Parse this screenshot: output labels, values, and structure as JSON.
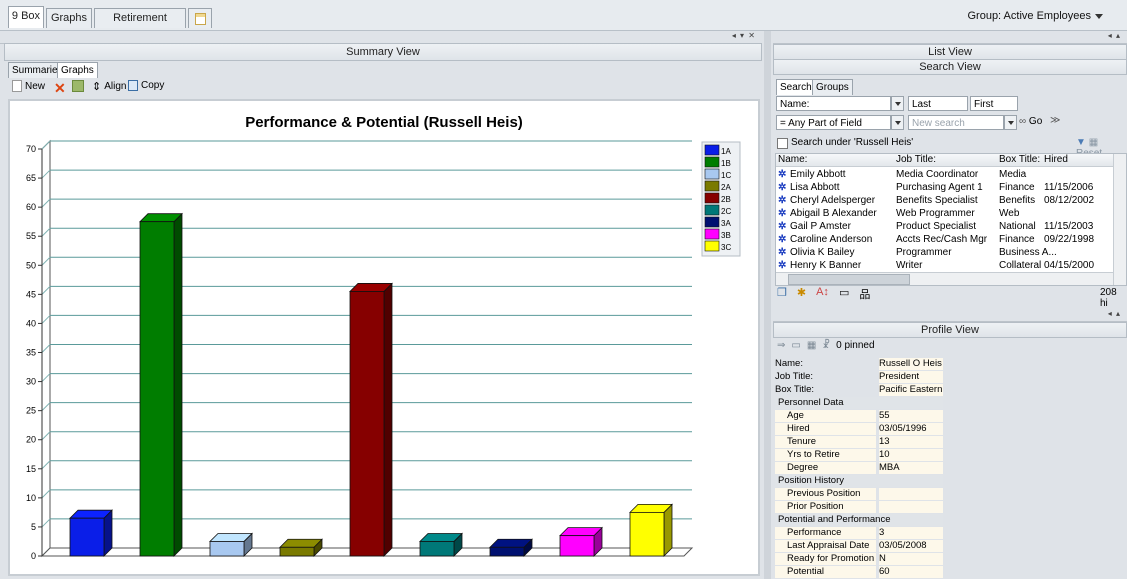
{
  "topbar": {
    "tabs": [
      "9 Box",
      "Graphs",
      "Retirement Tracking"
    ],
    "group": "Group: Active Employees"
  },
  "summary": {
    "title": "Summary View",
    "subtabs": [
      "Summaries",
      "Graphs"
    ],
    "toolbar": {
      "new": "New",
      "align": "Align",
      "copy": "Copy"
    }
  },
  "chart_data": {
    "type": "bar",
    "title": "Performance & Potential (Russell Heis)",
    "categories": [
      "1A",
      "1B",
      "1C",
      "2A",
      "2B",
      "2C",
      "3A",
      "3B",
      "3C"
    ],
    "values": [
      6.5,
      57.5,
      2.5,
      1.5,
      45.5,
      2.5,
      1.5,
      3.5,
      7.5
    ],
    "colors": [
      "#0a1ee8",
      "#007d00",
      "#a8c8f0",
      "#7a7a00",
      "#860000",
      "#007878",
      "#001070",
      "#ff00ff",
      "#ffff00"
    ],
    "ylim": [
      0,
      70
    ],
    "yticks": [
      0,
      5,
      10,
      15,
      20,
      25,
      30,
      35,
      40,
      45,
      50,
      55,
      60,
      65,
      70
    ],
    "legend": [
      "1A",
      "1B",
      "1C",
      "2A",
      "2B",
      "2C",
      "3A",
      "3B",
      "3C"
    ],
    "legend_position": "right",
    "grid": true
  },
  "list_view": {
    "title": "List View",
    "search_title": "Search View",
    "tabs": [
      "Search",
      "Groups"
    ],
    "name_field": "Name:",
    "last": "Last",
    "first": "First",
    "match_mode": "= Any Part of Field",
    "new_search_placeholder": "New search",
    "go": "Go",
    "search_under": "Search under 'Russell Heis'",
    "reset": "Reset",
    "columns": [
      "Name:",
      "Job Title:",
      "Box Title:",
      "Hired"
    ],
    "rows": [
      [
        "Emily  Abbott",
        "Media Coordinator",
        "Media",
        ""
      ],
      [
        "Lisa  Abbott",
        "Purchasing Agent 1",
        "Finance",
        "11/15/2006"
      ],
      [
        "Cheryl  Adelsperger",
        "Benefits Specialist",
        "Benefits",
        "08/12/2002"
      ],
      [
        "Abigail B Alexander",
        "Web Programmer",
        "Web",
        ""
      ],
      [
        "Gail P Amster",
        "Product Specialist",
        "National",
        "11/15/2003"
      ],
      [
        "Caroline  Anderson",
        "Accts Rec/Cash Mgr",
        "Finance",
        "09/22/1998"
      ],
      [
        "Olivia K Bailey",
        "Programmer",
        "Business A...",
        ""
      ],
      [
        "Henry K Banner",
        "Writer",
        "Collateral",
        "04/15/2000"
      ]
    ],
    "count": "208 hi"
  },
  "profile": {
    "title": "Profile View",
    "pinned": "0 pinned",
    "top": [
      [
        "Name:",
        "Russell O Heis"
      ],
      [
        "Job Title:",
        "President"
      ],
      [
        "Box Title:",
        "Pacific Eastern"
      ]
    ],
    "sections": [
      {
        "title": "Personnel Data",
        "rows": [
          [
            "Age",
            "55"
          ],
          [
            "Hired",
            "03/05/1996"
          ],
          [
            "Tenure",
            "13"
          ],
          [
            "Yrs to Retire",
            "10"
          ],
          [
            "Degree",
            "MBA"
          ]
        ]
      },
      {
        "title": "Position History",
        "rows": [
          [
            "Previous Position",
            ""
          ],
          [
            "Prior Position",
            ""
          ]
        ]
      },
      {
        "title": "Potential and Performance",
        "rows": [
          [
            "Performance",
            "3"
          ],
          [
            "Last Appraisal Date",
            "03/05/2008"
          ],
          [
            "Ready for Promotion",
            "N"
          ],
          [
            "Potential",
            "60"
          ]
        ]
      }
    ]
  }
}
